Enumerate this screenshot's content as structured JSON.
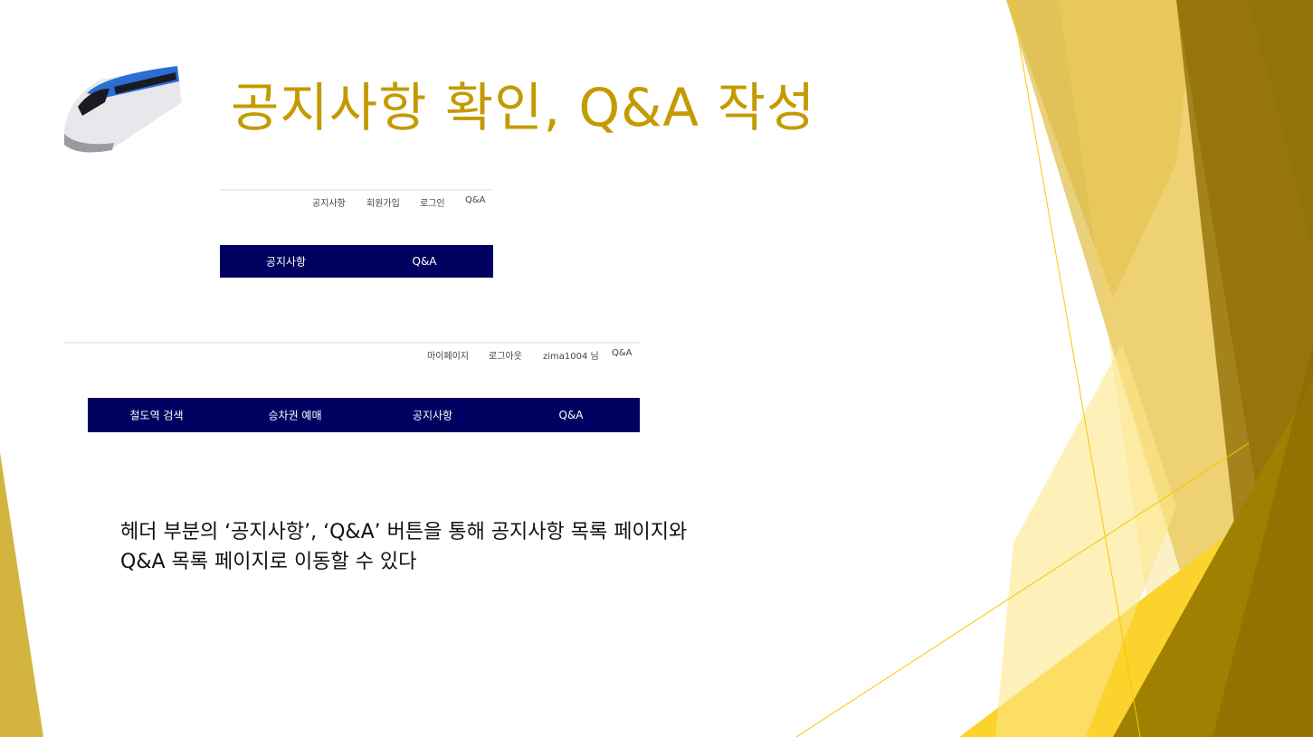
{
  "slide": {
    "title": "공지사항 확인, Q&A 작성",
    "description_line1": "헤더 부분의 ‘공지사항’, ‘Q&A’ 버튼을 통해 공지사항 목록 페이지와",
    "description_line2": "Q&A 목록 페이지로 이동할 수 있다"
  },
  "screenshot_guest": {
    "top_links": [
      "공지사항",
      "회원가입",
      "로그인",
      "Q&A"
    ],
    "nav": [
      "공지사항",
      "Q&A"
    ]
  },
  "screenshot_member": {
    "top_links": [
      "마이페이지",
      "로그아웃",
      "zima1004 님",
      "Q&A"
    ],
    "nav": [
      "철도역 검색",
      "승차권 예매",
      "공지사항",
      "Q&A"
    ]
  },
  "colors": {
    "title": "#c49a00",
    "nav_bg": "#000060",
    "accent": "#e0c040"
  }
}
